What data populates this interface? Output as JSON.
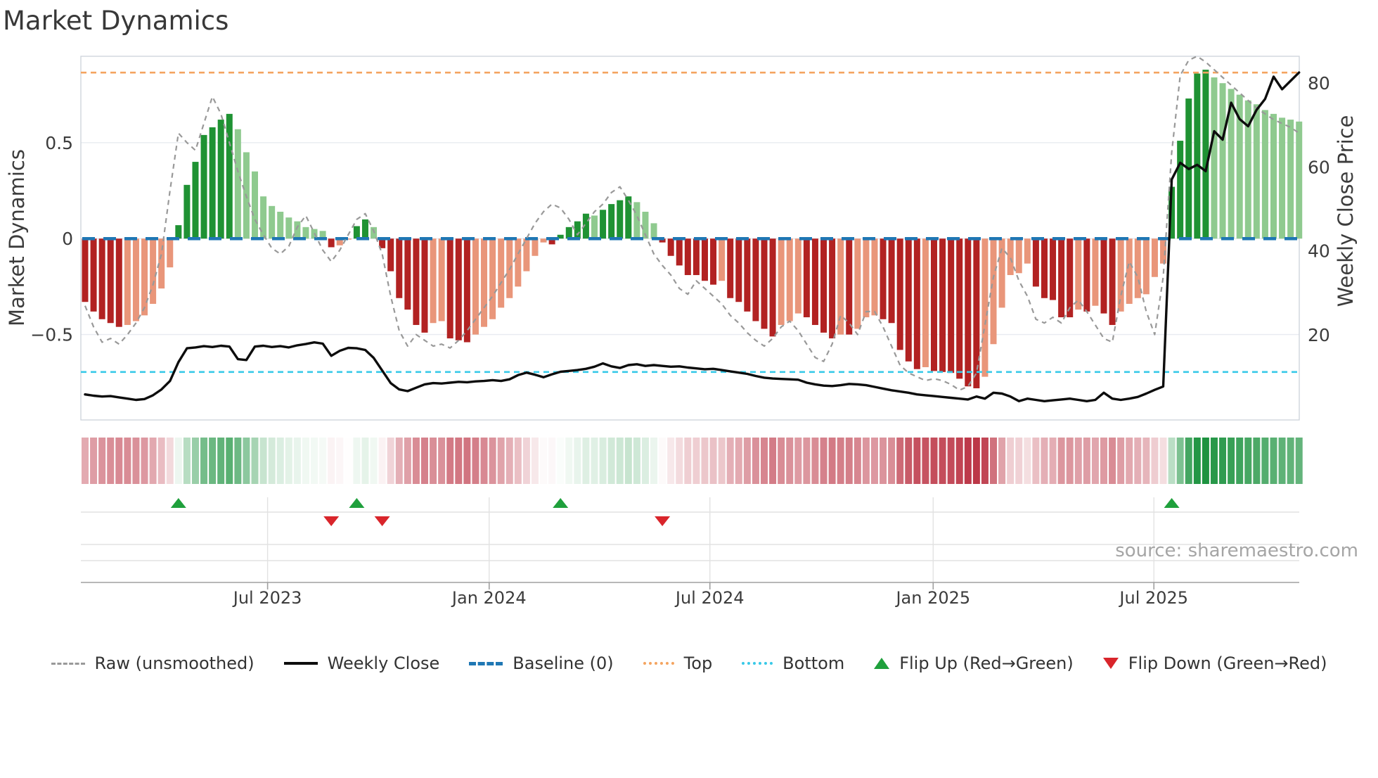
{
  "title": "Market Dynamics",
  "source_text": "source: sharemaestro.com",
  "axes": {
    "left_label": "Market Dynamics",
    "right_label": "Weekly Close Price",
    "left_ticks": [
      {
        "value": 0.5,
        "label": "0.5"
      },
      {
        "value": 0,
        "label": "0"
      },
      {
        "value": -0.5,
        "label": "−0.5"
      }
    ],
    "right_ticks": [
      {
        "value": 80,
        "label": "80"
      },
      {
        "value": 60,
        "label": "60"
      },
      {
        "value": 40,
        "label": "40"
      },
      {
        "value": 20,
        "label": "20"
      }
    ],
    "x_ticks": [
      {
        "week": 21.5,
        "label": "Jul 2023"
      },
      {
        "week": 47.6,
        "label": "Jan 2024"
      },
      {
        "week": 73.6,
        "label": "Jul 2024"
      },
      {
        "week": 99.9,
        "label": "Jan 2025"
      },
      {
        "week": 125.9,
        "label": "Jul 2025"
      }
    ]
  },
  "legend": [
    {
      "label": "Raw (unsmoothed)",
      "swatch": "dashed-gray",
      "kind": "line"
    },
    {
      "label": "Weekly Close",
      "swatch": "solid-black",
      "kind": "line"
    },
    {
      "label": "Baseline (0)",
      "swatch": "dash-blue",
      "kind": "line"
    },
    {
      "label": "Top",
      "swatch": "dot-orange",
      "kind": "line"
    },
    {
      "label": "Bottom",
      "swatch": "dot-cyan",
      "kind": "line"
    },
    {
      "label": "Flip Up (Red→Green)",
      "swatch": "tri-up",
      "kind": "marker"
    },
    {
      "label": "Flip Down (Green→Red)",
      "swatch": "tri-down",
      "kind": "marker"
    }
  ],
  "colors": {
    "bar_up_strong": "#1f9233",
    "bar_up_soft": "#8fca8f",
    "bar_down_strong": "#b22222",
    "bar_down_soft": "#e9967a",
    "baseline": "#1f77b4",
    "top_line": "#f4a460",
    "bottom_line": "#38c9e8",
    "raw_line": "#999999",
    "close_line": "#0d0d0d",
    "flip_up": "#1fa03c",
    "flip_down": "#d9252b",
    "heat_red": "#b2182b",
    "heat_green": "#19913c",
    "grid": "#e8ebf1",
    "strip_grid": "#e2e2e2",
    "spine": "#ccd2da",
    "axis_line": "#9f9f9f",
    "text": "#3c3c3c",
    "muted": "#a5a5a5"
  },
  "chart_data": {
    "type": "bar+line combo: weekly oscillator bars (left axis), raw dashed line (left axis), weekly close price line (right axis), heatmap strip and flip-marker strip below",
    "x_unit": "weeks, Feb 2023 → Oct 2025, 144 weekly points",
    "baseline": 0,
    "top_level": 0.865,
    "bottom_level": -0.695,
    "left_ylim": [
      -0.95,
      0.95
    ],
    "right_ylim": [
      0,
      87
    ],
    "grid": "horizontal at -0.5, 0, 0.5",
    "legend_position": "bottom center row",
    "oscillator": [
      -0.33,
      -0.38,
      -0.42,
      -0.44,
      -0.46,
      -0.45,
      -0.43,
      -0.4,
      -0.34,
      -0.26,
      -0.15,
      0.07,
      0.28,
      0.4,
      0.54,
      0.58,
      0.62,
      0.65,
      0.57,
      0.45,
      0.35,
      0.22,
      0.17,
      0.14,
      0.11,
      0.09,
      0.06,
      0.05,
      0.04,
      -0.045,
      -0.035,
      -0.005,
      0.065,
      0.1,
      0.06,
      -0.05,
      -0.17,
      -0.31,
      -0.37,
      -0.45,
      -0.49,
      -0.44,
      -0.43,
      -0.52,
      -0.53,
      -0.54,
      -0.5,
      -0.46,
      -0.42,
      -0.36,
      -0.31,
      -0.25,
      -0.17,
      -0.09,
      -0.02,
      -0.03,
      0.02,
      0.06,
      0.09,
      0.13,
      0.12,
      0.15,
      0.18,
      0.2,
      0.22,
      0.19,
      0.14,
      0.08,
      -0.02,
      -0.09,
      -0.14,
      -0.19,
      -0.19,
      -0.22,
      -0.24,
      -0.22,
      -0.31,
      -0.33,
      -0.38,
      -0.43,
      -0.47,
      -0.51,
      -0.45,
      -0.43,
      -0.39,
      -0.41,
      -0.45,
      -0.49,
      -0.52,
      -0.5,
      -0.5,
      -0.47,
      -0.41,
      -0.4,
      -0.42,
      -0.44,
      -0.58,
      -0.64,
      -0.68,
      -0.67,
      -0.69,
      -0.695,
      -0.7,
      -0.73,
      -0.77,
      -0.78,
      -0.72,
      -0.55,
      -0.36,
      -0.19,
      -0.18,
      -0.13,
      -0.25,
      -0.31,
      -0.32,
      -0.41,
      -0.41,
      -0.37,
      -0.38,
      -0.35,
      -0.39,
      -0.45,
      -0.38,
      -0.34,
      -0.31,
      -0.29,
      -0.2,
      -0.13,
      0.27,
      0.51,
      0.73,
      0.86,
      0.88,
      0.84,
      0.81,
      0.78,
      0.75,
      0.72,
      0.7,
      0.67,
      0.65,
      0.63,
      0.62,
      0.61
    ],
    "raw": [
      -0.35,
      -0.46,
      -0.54,
      -0.52,
      -0.55,
      -0.5,
      -0.44,
      -0.36,
      -0.24,
      -0.08,
      0.25,
      0.55,
      0.5,
      0.46,
      0.6,
      0.74,
      0.65,
      0.5,
      0.35,
      0.22,
      0.1,
      0.02,
      -0.05,
      -0.08,
      -0.04,
      0.06,
      0.12,
      0.03,
      -0.06,
      -0.12,
      -0.06,
      0.02,
      0.1,
      0.13,
      0.04,
      -0.08,
      -0.3,
      -0.48,
      -0.56,
      -0.5,
      -0.53,
      -0.56,
      -0.55,
      -0.57,
      -0.53,
      -0.48,
      -0.42,
      -0.36,
      -0.3,
      -0.23,
      -0.16,
      -0.08,
      0.0,
      0.08,
      0.14,
      0.18,
      0.16,
      0.1,
      0.02,
      0.08,
      0.14,
      0.18,
      0.24,
      0.27,
      0.2,
      0.12,
      0.02,
      -0.08,
      -0.14,
      -0.19,
      -0.26,
      -0.29,
      -0.22,
      -0.26,
      -0.3,
      -0.34,
      -0.4,
      -0.44,
      -0.49,
      -0.53,
      -0.56,
      -0.52,
      -0.46,
      -0.43,
      -0.48,
      -0.55,
      -0.62,
      -0.64,
      -0.55,
      -0.4,
      -0.44,
      -0.5,
      -0.38,
      -0.38,
      -0.46,
      -0.56,
      -0.66,
      -0.7,
      -0.72,
      -0.74,
      -0.73,
      -0.74,
      -0.76,
      -0.79,
      -0.77,
      -0.7,
      -0.45,
      -0.2,
      -0.05,
      -0.1,
      -0.22,
      -0.3,
      -0.42,
      -0.44,
      -0.41,
      -0.44,
      -0.36,
      -0.32,
      -0.38,
      -0.45,
      -0.52,
      -0.54,
      -0.3,
      -0.12,
      -0.2,
      -0.38,
      -0.5,
      -0.2,
      0.45,
      0.85,
      0.93,
      0.95,
      0.92,
      0.88,
      0.84,
      0.8,
      0.76,
      0.72,
      0.68,
      0.65,
      0.62,
      0.6,
      0.58,
      0.55
    ],
    "weekly_close": [
      5.8,
      5.5,
      5.3,
      5.4,
      5.1,
      4.8,
      4.5,
      4.7,
      5.6,
      7.0,
      9.0,
      13.5,
      16.8,
      17.0,
      17.3,
      17.1,
      17.4,
      17.2,
      14.2,
      14.0,
      17.2,
      17.4,
      17.1,
      17.3,
      17.0,
      17.5,
      17.8,
      18.2,
      17.9,
      15.0,
      16.2,
      16.9,
      16.8,
      16.4,
      14.5,
      11.5,
      8.5,
      7.0,
      6.6,
      7.4,
      8.2,
      8.5,
      8.4,
      8.6,
      8.8,
      8.7,
      8.9,
      9.0,
      9.2,
      9.0,
      9.4,
      10.4,
      11.0,
      10.5,
      9.9,
      10.6,
      11.2,
      11.4,
      11.6,
      11.9,
      12.4,
      13.2,
      12.5,
      12.1,
      12.8,
      13.0,
      12.6,
      12.8,
      12.6,
      12.4,
      12.5,
      12.2,
      12.0,
      11.8,
      11.9,
      11.6,
      11.3,
      11.0,
      10.7,
      10.2,
      9.8,
      9.6,
      9.5,
      9.4,
      9.3,
      8.6,
      8.2,
      7.9,
      7.8,
      8.0,
      8.3,
      8.2,
      8.0,
      7.6,
      7.2,
      6.8,
      6.5,
      6.2,
      5.8,
      5.6,
      5.4,
      5.2,
      5.0,
      4.8,
      4.6,
      5.3,
      4.8,
      6.2,
      6.0,
      5.3,
      4.2,
      4.8,
      4.5,
      4.2,
      4.4,
      4.6,
      4.8,
      4.5,
      4.2,
      4.5,
      6.2,
      4.8,
      4.5,
      4.8,
      5.2,
      6.0,
      6.9,
      7.7,
      57,
      61,
      59.5,
      60.5,
      59,
      68.5,
      66.5,
      75.3,
      71.4,
      69.7,
      73.6,
      76.2,
      81.5,
      78.5,
      80.5,
      82.5
    ],
    "flip_up_weeks": [
      11,
      32,
      56,
      128
    ],
    "flip_down_weeks": [
      29,
      35,
      68
    ]
  }
}
